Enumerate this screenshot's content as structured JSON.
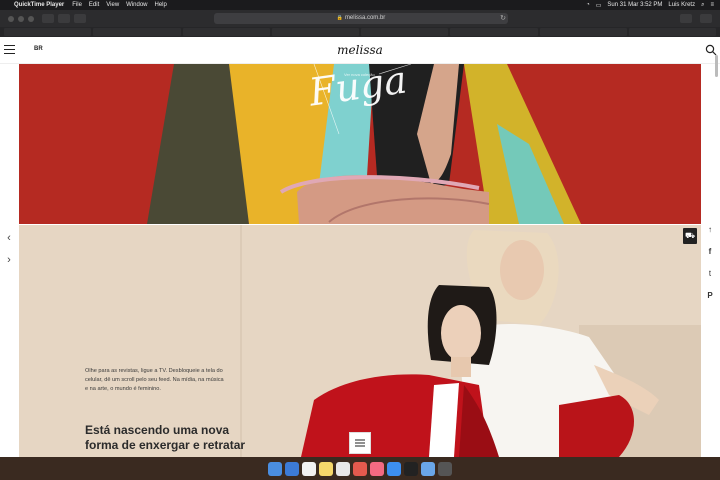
{
  "menubar": {
    "app_name": "QuickTime Player",
    "items": [
      "File",
      "Edit",
      "View",
      "Window",
      "Help"
    ],
    "clock": "Sun 31 Mar  3:52 PM",
    "user": "Luis Kretz"
  },
  "browser": {
    "url": "melissa.com.br"
  },
  "site": {
    "lang": "BR",
    "logo": "melissa",
    "hero_script_text": "Fuga",
    "hero_small_text": "Ver nova coleção",
    "body_copy": "Olhe para as revistas, ligue a TV. Desbloqueie a tela do celular, dê um scroll pelo seu feed. Na mídia, na música e na arte, o mundo é feminino.",
    "headline": "Está nascendo uma nova forma de enxergar e retratar"
  },
  "colors": {
    "hero_red": "#b52a22",
    "hero_beige": "#e6d6c3",
    "jacket_red": "#c0121b"
  },
  "icons": {
    "share": [
      "arrow-up-icon",
      "facebook-icon",
      "twitter-icon",
      "pinterest-icon"
    ]
  }
}
